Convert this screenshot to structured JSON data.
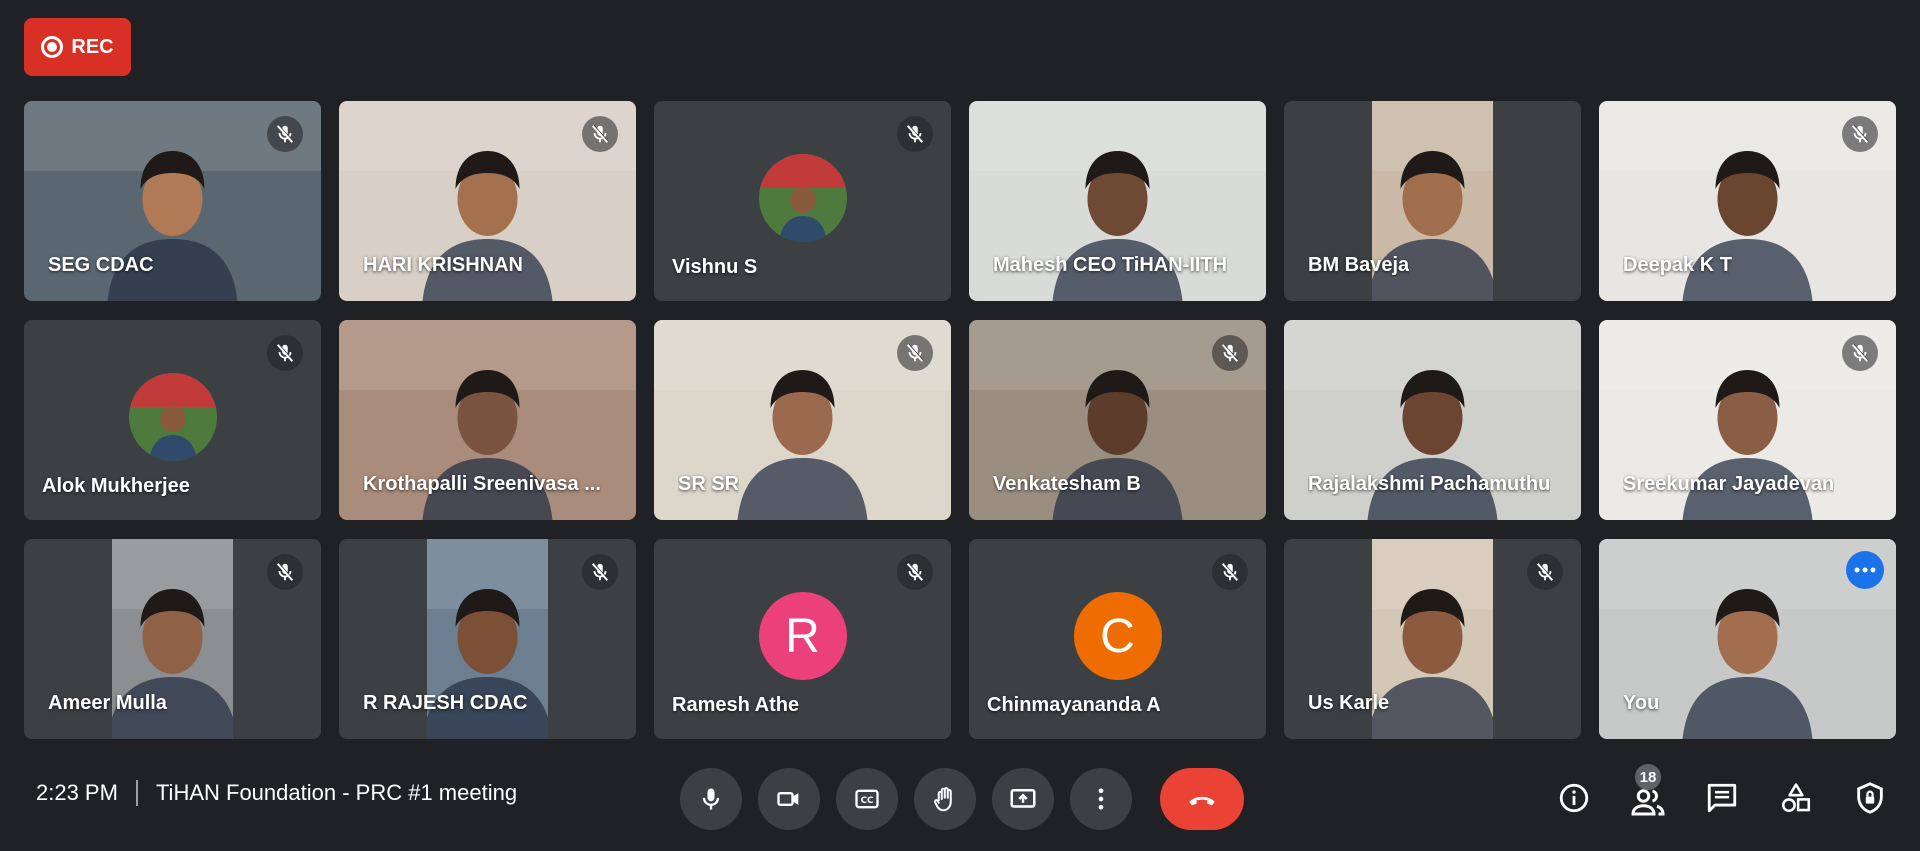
{
  "recording": {
    "label": "REC"
  },
  "participants": [
    {
      "name": "SEG CDAC",
      "muted": true,
      "bg": "#5b6770",
      "skin": "#b07a57"
    },
    {
      "name": "HARI KRISHNAN",
      "muted": true,
      "bg": "#d8cfc6",
      "skin": "#a4704e"
    },
    {
      "name": "Vishnu S",
      "muted": true,
      "bg": "#3c4043",
      "avatar": "photo"
    },
    {
      "name": "Mahesh CEO TiHAN-IITH",
      "muted": false,
      "bg": "#d9dbd8",
      "skin": "#6e4a35"
    },
    {
      "name": "BM Baveja",
      "muted": false,
      "bg": "#c9b9a6",
      "skin": "#a06d4d",
      "narrow": true
    },
    {
      "name": "Deepak K T",
      "muted": true,
      "bg": "#e8e6e2",
      "skin": "#6a4530"
    },
    {
      "name": "Alok Mukherjee",
      "muted": true,
      "bg": "#3c4043",
      "avatar": "photo"
    },
    {
      "name": "Krothapalli Sreenivasa ...",
      "muted": false,
      "bg": "#a98c7b",
      "skin": "#7a5440"
    },
    {
      "name": "SR SR",
      "muted": true,
      "bg": "#dcd6cb",
      "skin": "#9b6a4e"
    },
    {
      "name": "Venkatesham B",
      "muted": true,
      "bg": "#9a8e80",
      "skin": "#5c3d2c"
    },
    {
      "name": "Rajalakshmi Pachamuthu",
      "muted": false,
      "bg": "#cfd0cc",
      "skin": "#6b4432"
    },
    {
      "name": "Sreekumar Jayadevan",
      "muted": true,
      "bg": "#eceae6",
      "skin": "#8a5d45"
    },
    {
      "name": "Ameer Mulla",
      "muted": true,
      "bg": "#8b8f92",
      "skin": "#8f6248",
      "narrow": true
    },
    {
      "name": "R RAJESH CDAC",
      "muted": true,
      "bg": "#6c7f91",
      "skin": "#7b5036",
      "narrow": true
    },
    {
      "name": "Ramesh Athe",
      "muted": true,
      "bg": "#3c4043",
      "avatar": "letter",
      "letter": "R",
      "avatar_color": "#ec407a"
    },
    {
      "name": "Chinmayananda A",
      "muted": true,
      "bg": "#3c4043",
      "avatar": "letter",
      "letter": "C",
      "avatar_color": "#ef6c00"
    },
    {
      "name": "Us Karle",
      "muted": true,
      "bg": "#d3c7b5",
      "skin": "#8c5b3f",
      "narrow": true
    },
    {
      "name": "You",
      "muted": false,
      "bg": "#c7c9c8",
      "skin": "#a36e4f",
      "self": true
    }
  ],
  "meeting": {
    "time": "2:23 PM",
    "title": "TiHAN Foundation - PRC #1 meeting"
  },
  "people_count": "18",
  "colors": {
    "background": "#202124",
    "tile": "#3c4043",
    "end_call": "#ea4335",
    "rec": "#d93025",
    "self_border": "#669df6"
  }
}
